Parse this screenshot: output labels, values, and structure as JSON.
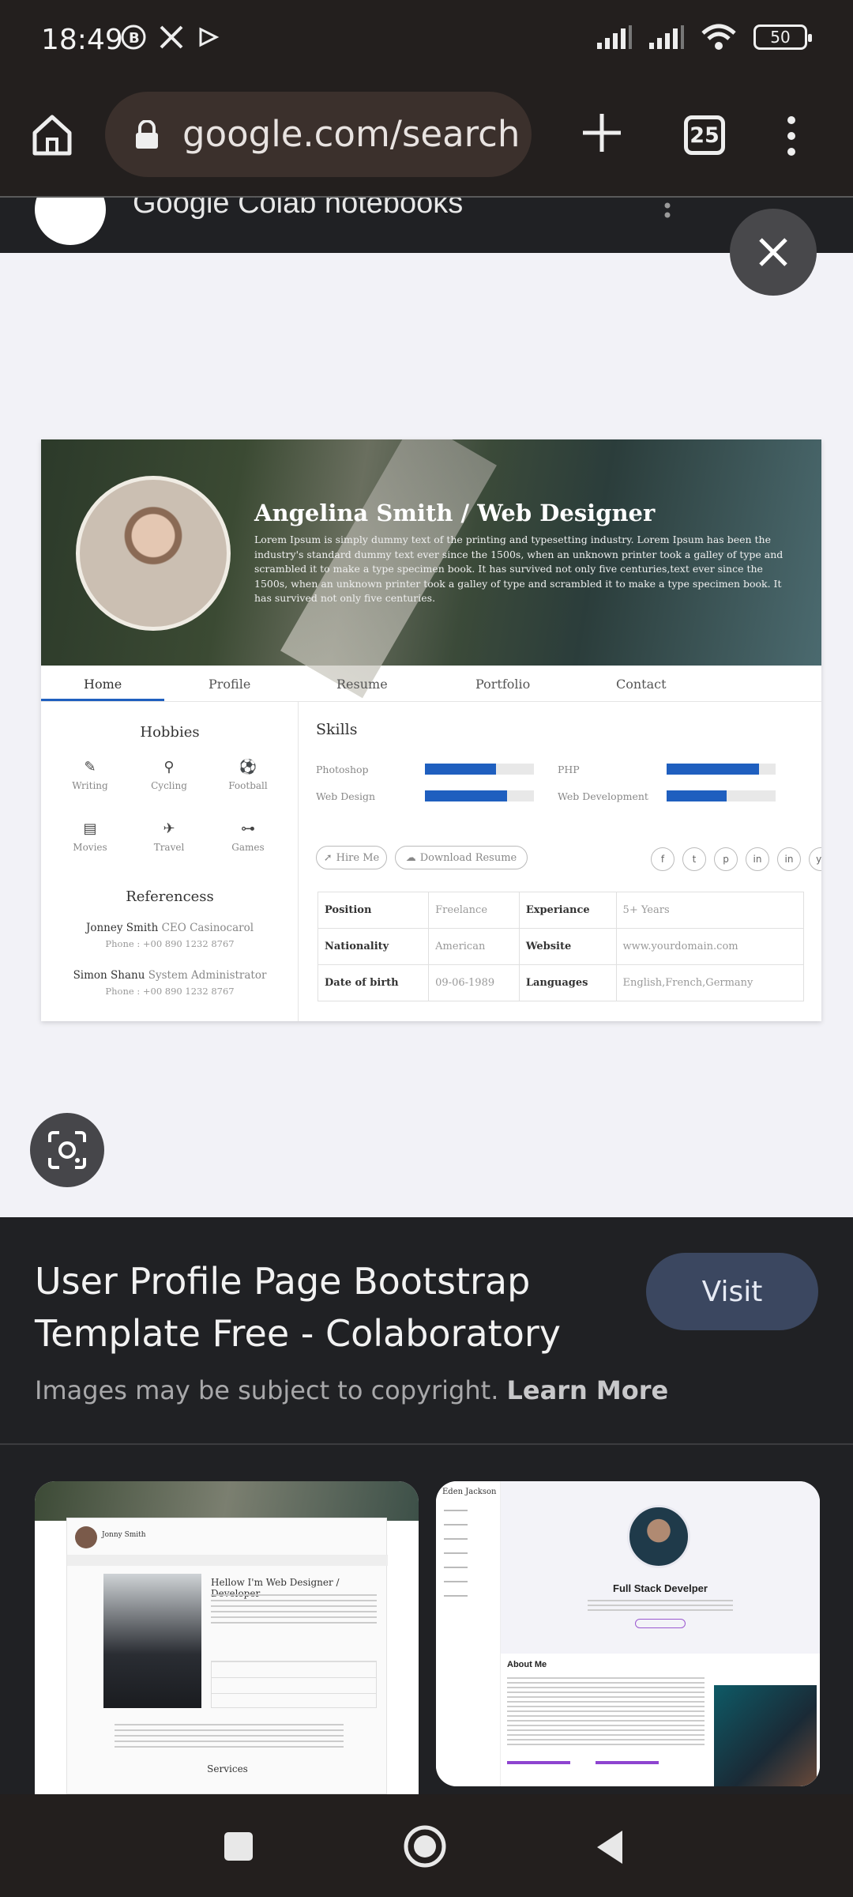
{
  "status_bar": {
    "time": "18:49",
    "battery": "50"
  },
  "browser": {
    "url": "google.com/search?q",
    "tab_count": "25"
  },
  "background_page": {
    "result_title": "Google Colab notebooks"
  },
  "preview": {
    "banner_title": "Angelina Smith / Web Designer",
    "banner_description": "Lorem Ipsum is simply dummy text of the printing and typesetting industry. Lorem Ipsum has been the industry's standard dummy text ever since the 1500s, when an unknown printer took a galley of type and scrambled it to make a type specimen book. It has survived not only five centuries,text ever since the 1500s, when an unknown printer took a galley of type and scrambled it to make a type specimen book. It has survived not only five centuries.",
    "nav": [
      "Home",
      "Profile",
      "Resume",
      "Portfolio",
      "Contact"
    ],
    "hobbies_title": "Hobbies",
    "hobbies": [
      {
        "label": "Writing",
        "icon": "pencil-icon"
      },
      {
        "label": "Cycling",
        "icon": "bicycle-icon"
      },
      {
        "label": "Football",
        "icon": "football-icon"
      },
      {
        "label": "Movies",
        "icon": "film-icon"
      },
      {
        "label": "Travel",
        "icon": "plane-icon"
      },
      {
        "label": "Games",
        "icon": "gamepad-icon"
      }
    ],
    "references_title": "Referencess",
    "references": [
      {
        "name": "Jonney Smith",
        "role": "CEO Casinocarol",
        "phone": "Phone : +00 890 1232 8767"
      },
      {
        "name": "Simon Shanu",
        "role": "System Administrator",
        "phone": "Phone : +00 890 1232 8767"
      }
    ],
    "skills_title": "Skills",
    "skills": [
      {
        "label": "Photoshop",
        "level": 0.65
      },
      {
        "label": "PHP",
        "level": 0.85
      },
      {
        "label": "Web Design",
        "level": 0.75
      },
      {
        "label": "Web Development",
        "level": 0.55
      }
    ],
    "buttons": {
      "hire": "Hire Me",
      "download": "Download Resume"
    },
    "socials": [
      "f",
      "t",
      "p",
      "in",
      "in",
      "yt"
    ],
    "info": [
      {
        "k1": "Position",
        "v1": "Freelance",
        "k2": "Experiance",
        "v2": "5+ Years"
      },
      {
        "k1": "Nationality",
        "v1": "American",
        "k2": "Website",
        "v2": "www.yourdomain.com"
      },
      {
        "k1": "Date of birth",
        "v1": "09-06-1989",
        "k2": "Languages",
        "v2": "English,French,Germany"
      }
    ]
  },
  "result": {
    "title": "User Profile Page Bootstrap Template Free - Colaboratory",
    "visit": "Visit",
    "copyright": "Images may be subject to copyright.",
    "learn_more": "Learn More"
  },
  "related": {
    "thumb1": {
      "name": "Jonny Smith",
      "heading": "Hellow I'm Web Designer / Developer",
      "services": "Services"
    },
    "thumb2": {
      "brand": "Eden Jackson",
      "title": "Full Stack Develper",
      "about": "About Me"
    }
  }
}
